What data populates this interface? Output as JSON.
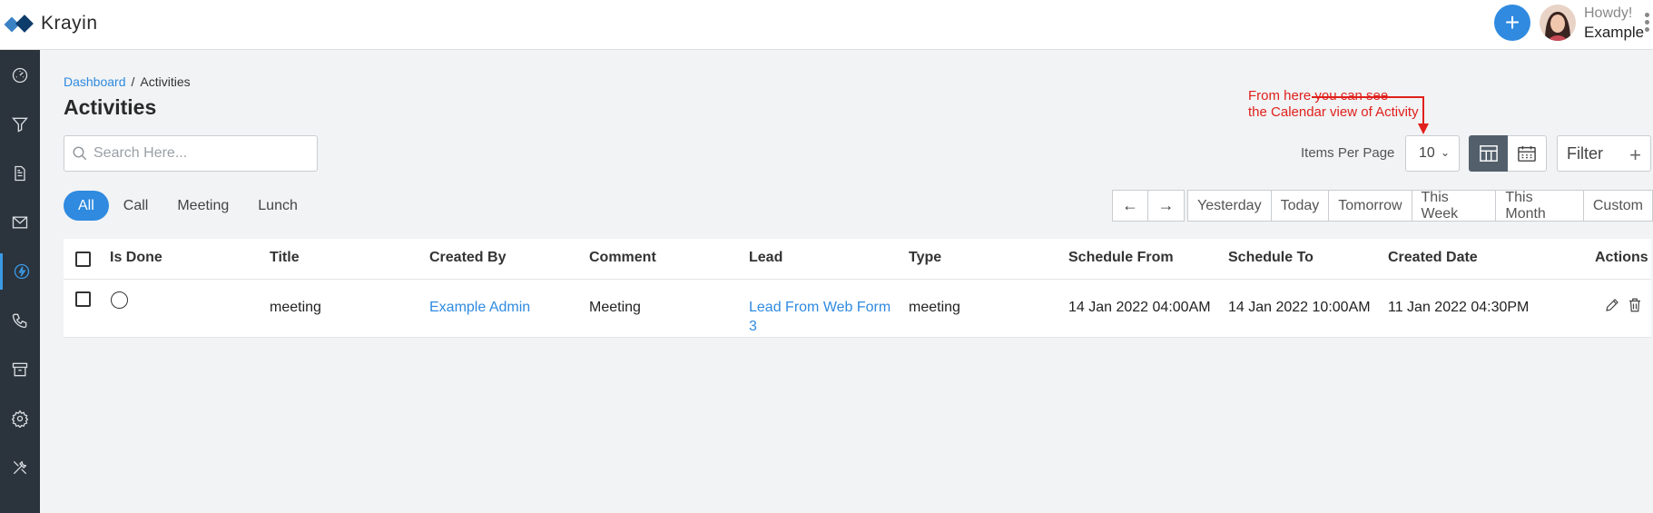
{
  "app": {
    "name": "Krayin"
  },
  "header": {
    "quick_add_icon": "plus-icon",
    "greeting": "Howdy!",
    "username": "Example"
  },
  "sidebar": {
    "items": [
      {
        "name": "dashboard",
        "icon": "gauge-icon"
      },
      {
        "name": "leads",
        "icon": "funnel-icon"
      },
      {
        "name": "quotes",
        "icon": "document-icon"
      },
      {
        "name": "mail",
        "icon": "mail-icon"
      },
      {
        "name": "activities",
        "icon": "bolt-icon",
        "active": true
      },
      {
        "name": "contacts",
        "icon": "phone-icon"
      },
      {
        "name": "products",
        "icon": "archive-icon"
      },
      {
        "name": "settings",
        "icon": "gear-icon"
      },
      {
        "name": "configuration",
        "icon": "tools-icon"
      }
    ]
  },
  "breadcrumb": {
    "home": "Dashboard",
    "separator": "/",
    "current": "Activities"
  },
  "page": {
    "title": "Activities"
  },
  "search": {
    "placeholder": "Search Here...",
    "value": ""
  },
  "annotation": {
    "line1": "From here you can see",
    "line2": "the Calendar view of Activity",
    "color": "#e0201c"
  },
  "toolbar": {
    "items_per_page_label": "Items Per Page",
    "items_per_page_value": "10",
    "filter_label": "Filter",
    "filter_plus": "+"
  },
  "type_tabs": [
    {
      "label": "All",
      "active": true
    },
    {
      "label": "Call"
    },
    {
      "label": "Meeting"
    },
    {
      "label": "Lunch"
    }
  ],
  "date_nav": {
    "prev": "←",
    "next": "→"
  },
  "date_filters": [
    "Yesterday",
    "Today",
    "Tomorrow",
    "This Week",
    "This Month",
    "Custom"
  ],
  "table": {
    "columns": [
      "Is Done",
      "Title",
      "Created By",
      "Comment",
      "Lead",
      "Type",
      "Schedule From",
      "Schedule To",
      "Created Date",
      "Actions"
    ],
    "rows": [
      {
        "title": "meeting",
        "created_by": "Example Admin",
        "comment": "Meeting",
        "lead_line1": "Lead From Web Form",
        "lead_line2": "3",
        "type": "meeting",
        "schedule_from": "14 Jan 2022 04:00AM",
        "schedule_to": "14 Jan 2022 10:00AM",
        "created_date": "11 Jan 2022 04:30PM"
      }
    ]
  },
  "colors": {
    "accent": "#2f8ae0",
    "sidebar": "#2b333c",
    "active_view": "#53606c"
  }
}
